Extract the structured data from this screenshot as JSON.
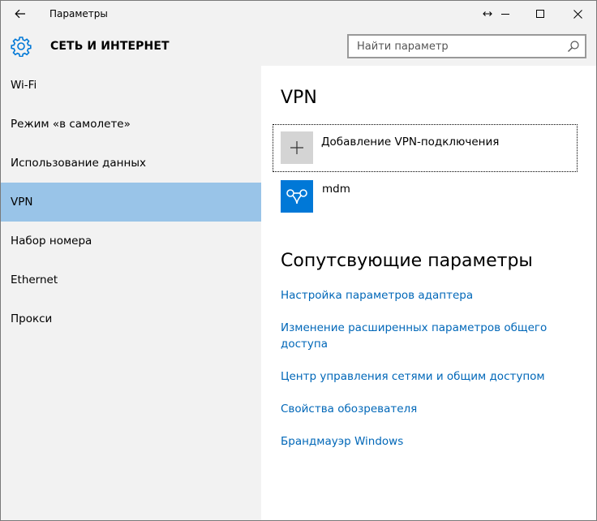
{
  "window": {
    "title": "Параметры"
  },
  "header": {
    "title": "СЕТЬ И ИНТЕРНЕТ",
    "icon": "gear-icon"
  },
  "search": {
    "placeholder": "Найти параметр",
    "value": ""
  },
  "sidebar": {
    "items": [
      {
        "label": "Wi-Fi",
        "selected": false
      },
      {
        "label": "Режим «в самолете»",
        "selected": false
      },
      {
        "label": "Использование данных",
        "selected": false
      },
      {
        "label": "VPN",
        "selected": true
      },
      {
        "label": "Набор номера",
        "selected": false
      },
      {
        "label": "Ethernet",
        "selected": false
      },
      {
        "label": "Прокси",
        "selected": false
      }
    ]
  },
  "main": {
    "title": "VPN",
    "add_vpn_label": "Добавление VPN-подключения",
    "vpn_connections": [
      {
        "name": "mdm",
        "icon": "vpn-connection-icon"
      }
    ],
    "related_title": "Сопутсвующие параметры",
    "related_links": [
      {
        "label": "Настройка параметров адаптера"
      },
      {
        "label": "Изменение расширенных параметров общего доступа"
      },
      {
        "label": "Центр управления сетями и общим доступом"
      },
      {
        "label": "Свойства обозревателя"
      },
      {
        "label": "Брандмауэр Windows"
      }
    ]
  },
  "colors": {
    "accent": "#0078d7",
    "selection": "#99c4e8",
    "link": "#0067b8",
    "chrome": "#f2f2f2"
  }
}
